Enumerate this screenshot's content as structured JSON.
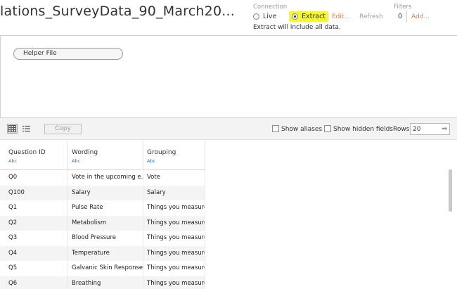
{
  "datasource": {
    "title": "lations_SurveyData_90_March20..."
  },
  "connection": {
    "label": "Connection",
    "live_label": "Live",
    "extract_label": "Extract",
    "selected": "Extract",
    "edit_label": "Edit...",
    "refresh_label": "Refresh",
    "note": "Extract will include all data.",
    "highlight_color": "#f5f53a",
    "link_color": "#e8772e"
  },
  "filters": {
    "label": "Filters",
    "count": "0",
    "add_label": "Add..."
  },
  "canvas": {
    "table_name": "Helper File"
  },
  "toolbar": {
    "copy_label": "Copy",
    "show_aliases_label": "Show aliases",
    "show_hidden_label": "Show hidden fields",
    "rows_label": "Rows",
    "rows_value": "20"
  },
  "grid": {
    "columns": [
      {
        "name": "Question ID",
        "type": "Abc"
      },
      {
        "name": "Wording",
        "type": "Abc"
      },
      {
        "name": "Grouping",
        "type": "Abc"
      }
    ],
    "rows": [
      [
        "Q0",
        "Vote in the upcoming e...",
        "Vote"
      ],
      [
        "Q100",
        "Salary",
        "Salary"
      ],
      [
        "Q1",
        "Pulse Rate",
        "Things you measure"
      ],
      [
        "Q2",
        "Metabolism",
        "Things you measure"
      ],
      [
        "Q3",
        "Blood Pressure",
        "Things you measure"
      ],
      [
        "Q4",
        "Temperature",
        "Things you measure"
      ],
      [
        "Q5",
        "Galvanic Skin Response",
        "Things you measure"
      ],
      [
        "Q6",
        "Breathing",
        "Things you measure"
      ]
    ]
  }
}
